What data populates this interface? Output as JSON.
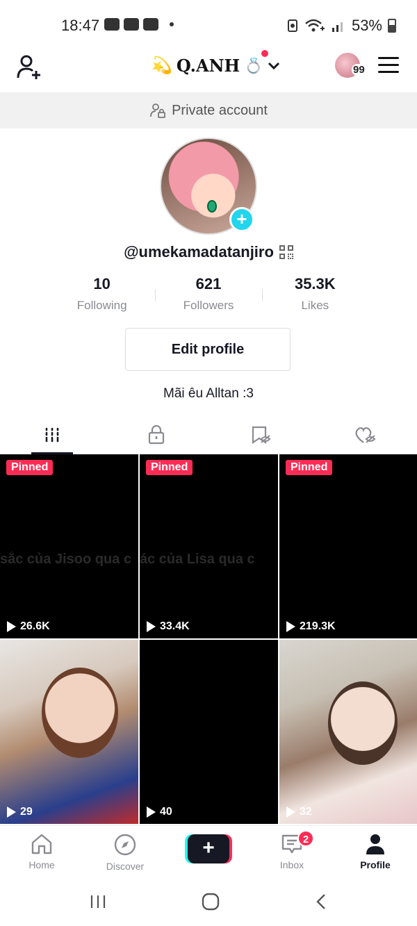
{
  "status_bar": {
    "time": "18:47",
    "battery": "53%"
  },
  "header": {
    "account_name": "Q.ANH",
    "account_prefix_emoji": "💫",
    "account_suffix_emoji": "💍",
    "notification_count": "99"
  },
  "private_banner": {
    "label": "Private account"
  },
  "profile": {
    "username": "@umekamadatanjiro",
    "stats": [
      {
        "value": "10",
        "label": "Following"
      },
      {
        "value": "621",
        "label": "Followers"
      },
      {
        "value": "35.3K",
        "label": "Likes"
      }
    ],
    "edit_button": "Edit profile",
    "bio": "Mãi êu Alltan :3"
  },
  "tabs": [
    {
      "name": "videos-tab",
      "icon": "grid-icon",
      "active": true
    },
    {
      "name": "private-tab",
      "icon": "lock-icon",
      "active": false
    },
    {
      "name": "favorites-tab",
      "icon": "bookmark-hidden-icon",
      "active": false
    },
    {
      "name": "liked-tab",
      "icon": "heart-hidden-icon",
      "active": false
    }
  ],
  "videos": [
    {
      "pinned": "Pinned",
      "views": "26.6K",
      "overlay": "sắc của Jisoo qua c"
    },
    {
      "pinned": "Pinned",
      "views": "33.4K",
      "overlay": "ác của Lisa qua c"
    },
    {
      "pinned": "Pinned",
      "views": "219.3K",
      "overlay": ""
    },
    {
      "pinned": "",
      "views": "29",
      "overlay": ""
    },
    {
      "pinned": "",
      "views": "40",
      "overlay": ""
    },
    {
      "pinned": "",
      "views": "32",
      "overlay": ""
    }
  ],
  "bottom_nav": {
    "home": "Home",
    "discover": "Discover",
    "create": "+",
    "inbox": "Inbox",
    "inbox_badge": "2",
    "profile": "Profile"
  },
  "colors": {
    "accent_red": "#fe2c55",
    "accent_cyan": "#20d5ec",
    "text_dark": "#161823",
    "text_muted": "#8a8b91"
  }
}
